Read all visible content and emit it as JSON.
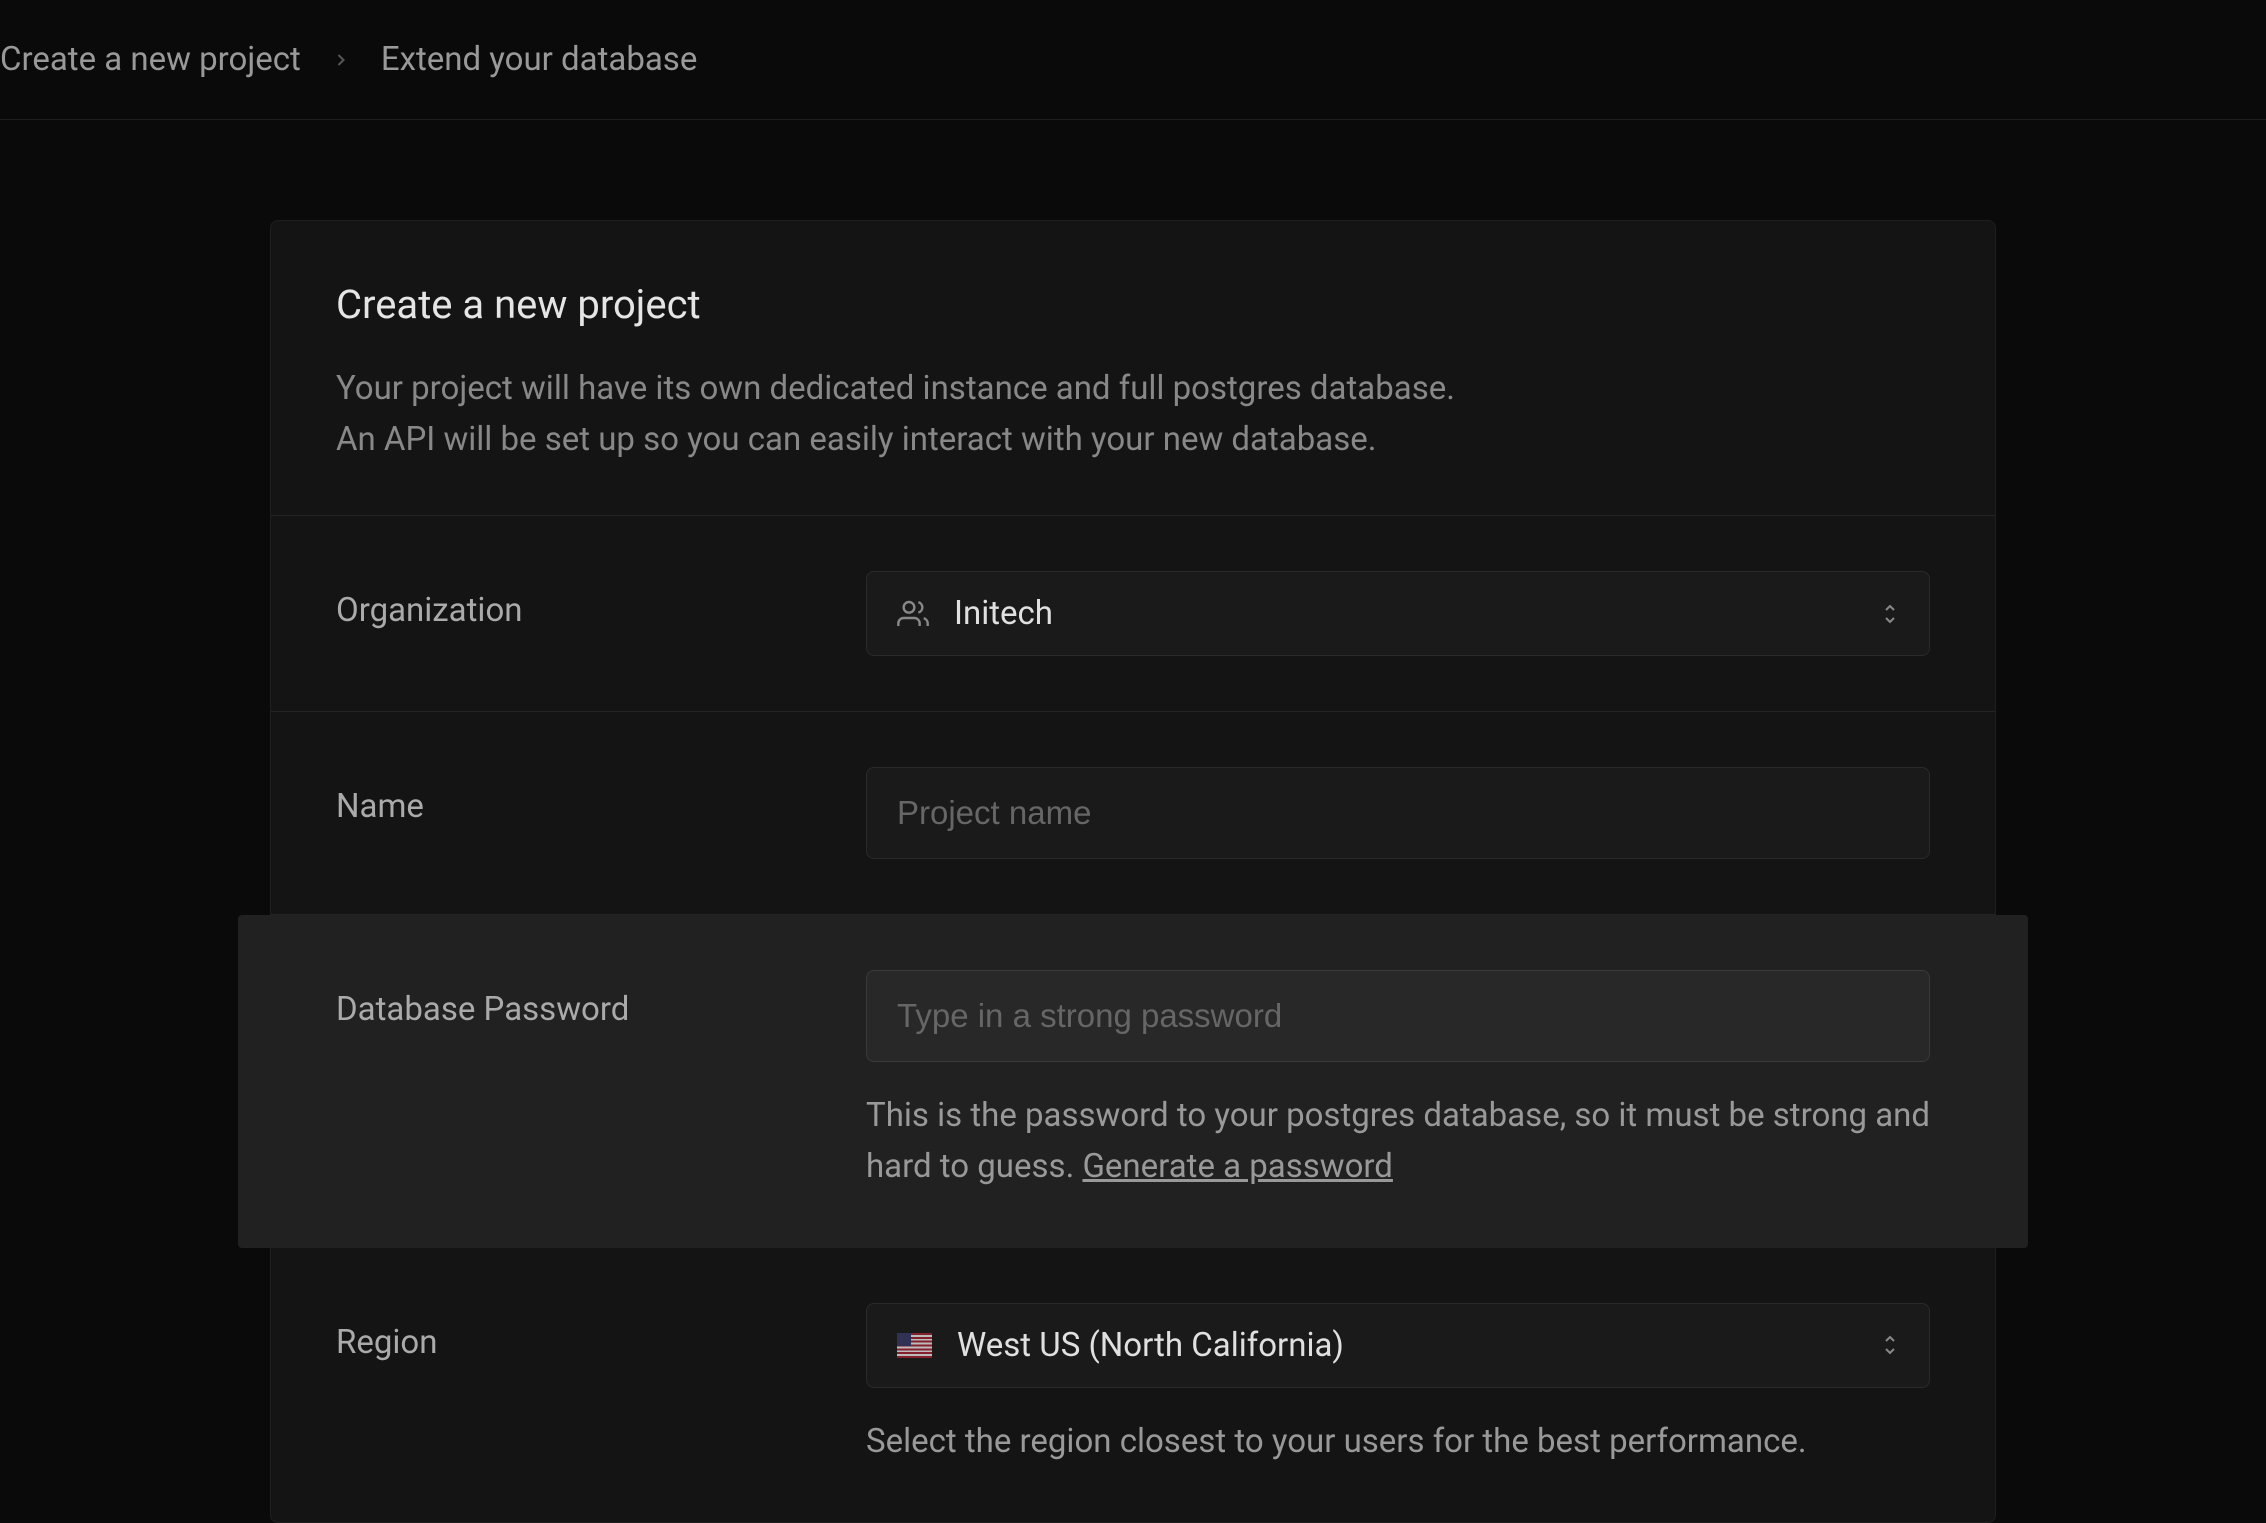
{
  "breadcrumb": {
    "item1": "Create a new project",
    "item2": "Extend your database"
  },
  "header": {
    "title": "Create a new project",
    "description_line1": "Your project will have its own dedicated instance and full postgres database.",
    "description_line2": "An API will be set up so you can easily interact with your new database."
  },
  "form": {
    "organization": {
      "label": "Organization",
      "value": "Initech"
    },
    "name": {
      "label": "Name",
      "placeholder": "Project name"
    },
    "password": {
      "label": "Database Password",
      "placeholder": "Type in a strong password",
      "helper_text": "This is the password to your postgres database, so it must be strong and hard to guess. ",
      "generate_link": "Generate a password"
    },
    "region": {
      "label": "Region",
      "value": "West US (North California)",
      "helper_text": "Select the region closest to your users for the best performance."
    }
  }
}
